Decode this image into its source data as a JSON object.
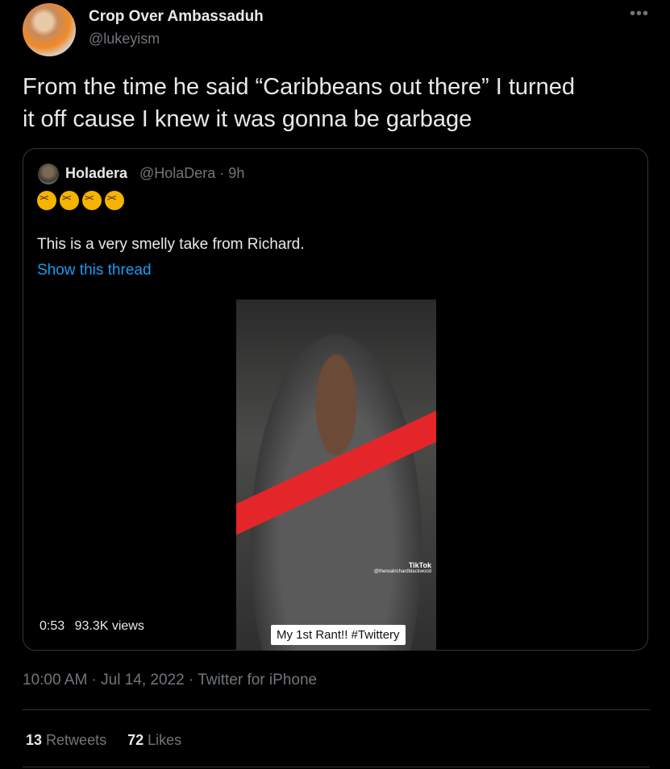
{
  "author": {
    "name": "Crop Over Ambassaduh",
    "handle": "@lukeyism"
  },
  "more_icon": "more-horizontal-icon",
  "tweet": {
    "text_line1": "From the time he said “Caribbeans out there” I turned",
    "text_line2": "it off cause I knew it was gonna be garbage"
  },
  "quoted": {
    "name": "Holadera",
    "handle": "@HolaDera · 9h",
    "emoji": [
      "confounded-face-icon",
      "confounded-face-icon",
      "confounded-face-icon",
      "confounded-face-icon"
    ],
    "text": "This is a very smelly take from Richard.",
    "show_thread": "Show this thread",
    "video": {
      "duration": "0:53",
      "views": "93.3K views",
      "caption": "My 1st Rant!! #Twittery",
      "watermark": "TikTok",
      "watermark_user": "@therealrichardblackwood"
    }
  },
  "meta": "10:00 AM · Jul 14, 2022 · Twitter for iPhone",
  "stats": {
    "retweets_count": "13",
    "retweets_label": "Retweets",
    "likes_count": "72",
    "likes_label": "Likes"
  },
  "colors": {
    "background": "#000000",
    "text": "#e7e9ea",
    "muted": "#71767b",
    "link": "#1d9bf0",
    "border": "#333639"
  }
}
